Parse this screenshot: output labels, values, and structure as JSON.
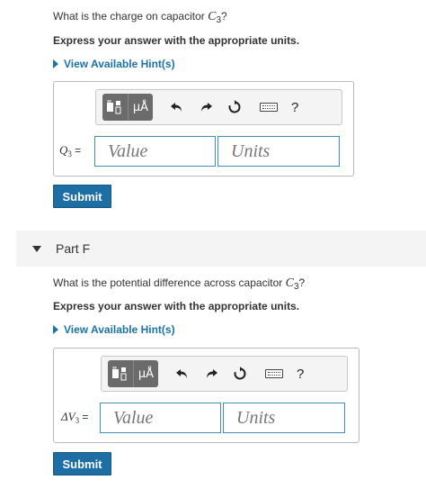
{
  "part_e": {
    "question_prefix": "What is the charge on capacitor ",
    "question_var": "C",
    "question_sub": "3",
    "question_suffix": "?",
    "instruction": "Express your answer with the appropriate units.",
    "hint_link": "View Available Hint(s)",
    "toolbar": {
      "units_symbol": "μÅ",
      "help": "?"
    },
    "label_var": "Q",
    "label_sub": "3",
    "label_eq": " =",
    "value_placeholder": "Value",
    "units_placeholder": "Units",
    "submit": "Submit"
  },
  "part_f": {
    "title": "Part F",
    "question_prefix": "What is the potential difference across capacitor ",
    "question_var": "C",
    "question_sub": "3",
    "question_suffix": "?",
    "instruction": "Express your answer with the appropriate units.",
    "hint_link": "View Available Hint(s)",
    "toolbar": {
      "units_symbol": "μÅ",
      "help": "?"
    },
    "label_var": "ΔV",
    "label_sub": "3",
    "label_eq": " =",
    "value_placeholder": "Value",
    "units_placeholder": "Units",
    "submit": "Submit"
  },
  "colors": {
    "accent": "#1c6ea4",
    "link": "#1d72a8",
    "field_border": "#3d8fb8",
    "part_header_bg": "#f4f4f4"
  },
  "icons": {
    "templates": "templates-icon",
    "units": "units-icon",
    "undo": "undo-icon",
    "redo": "redo-icon",
    "reset": "reset-icon",
    "keyboard": "keyboard-icon",
    "help": "help-icon"
  }
}
